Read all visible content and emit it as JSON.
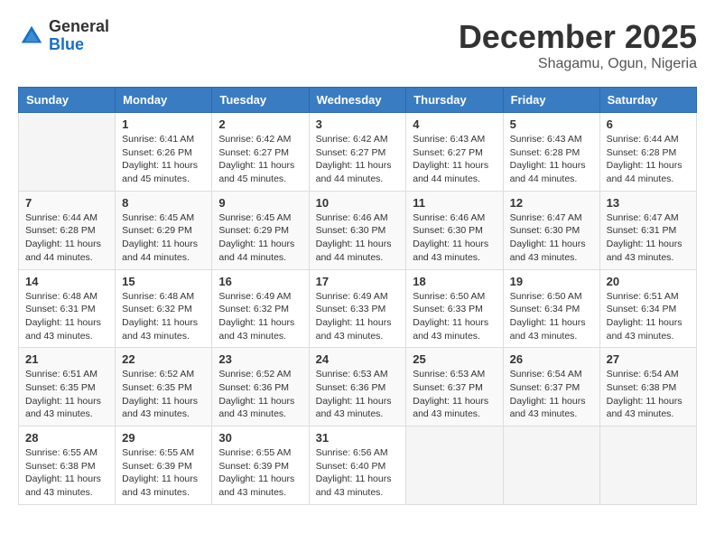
{
  "logo": {
    "general": "General",
    "blue": "Blue"
  },
  "title": "December 2025",
  "location": "Shagamu, Ogun, Nigeria",
  "weekdays": [
    "Sunday",
    "Monday",
    "Tuesday",
    "Wednesday",
    "Thursday",
    "Friday",
    "Saturday"
  ],
  "weeks": [
    [
      {
        "day": "",
        "info": ""
      },
      {
        "day": "1",
        "info": "Sunrise: 6:41 AM\nSunset: 6:26 PM\nDaylight: 11 hours\nand 45 minutes."
      },
      {
        "day": "2",
        "info": "Sunrise: 6:42 AM\nSunset: 6:27 PM\nDaylight: 11 hours\nand 45 minutes."
      },
      {
        "day": "3",
        "info": "Sunrise: 6:42 AM\nSunset: 6:27 PM\nDaylight: 11 hours\nand 44 minutes."
      },
      {
        "day": "4",
        "info": "Sunrise: 6:43 AM\nSunset: 6:27 PM\nDaylight: 11 hours\nand 44 minutes."
      },
      {
        "day": "5",
        "info": "Sunrise: 6:43 AM\nSunset: 6:28 PM\nDaylight: 11 hours\nand 44 minutes."
      },
      {
        "day": "6",
        "info": "Sunrise: 6:44 AM\nSunset: 6:28 PM\nDaylight: 11 hours\nand 44 minutes."
      }
    ],
    [
      {
        "day": "7",
        "info": "Sunrise: 6:44 AM\nSunset: 6:28 PM\nDaylight: 11 hours\nand 44 minutes."
      },
      {
        "day": "8",
        "info": "Sunrise: 6:45 AM\nSunset: 6:29 PM\nDaylight: 11 hours\nand 44 minutes."
      },
      {
        "day": "9",
        "info": "Sunrise: 6:45 AM\nSunset: 6:29 PM\nDaylight: 11 hours\nand 44 minutes."
      },
      {
        "day": "10",
        "info": "Sunrise: 6:46 AM\nSunset: 6:30 PM\nDaylight: 11 hours\nand 44 minutes."
      },
      {
        "day": "11",
        "info": "Sunrise: 6:46 AM\nSunset: 6:30 PM\nDaylight: 11 hours\nand 43 minutes."
      },
      {
        "day": "12",
        "info": "Sunrise: 6:47 AM\nSunset: 6:30 PM\nDaylight: 11 hours\nand 43 minutes."
      },
      {
        "day": "13",
        "info": "Sunrise: 6:47 AM\nSunset: 6:31 PM\nDaylight: 11 hours\nand 43 minutes."
      }
    ],
    [
      {
        "day": "14",
        "info": "Sunrise: 6:48 AM\nSunset: 6:31 PM\nDaylight: 11 hours\nand 43 minutes."
      },
      {
        "day": "15",
        "info": "Sunrise: 6:48 AM\nSunset: 6:32 PM\nDaylight: 11 hours\nand 43 minutes."
      },
      {
        "day": "16",
        "info": "Sunrise: 6:49 AM\nSunset: 6:32 PM\nDaylight: 11 hours\nand 43 minutes."
      },
      {
        "day": "17",
        "info": "Sunrise: 6:49 AM\nSunset: 6:33 PM\nDaylight: 11 hours\nand 43 minutes."
      },
      {
        "day": "18",
        "info": "Sunrise: 6:50 AM\nSunset: 6:33 PM\nDaylight: 11 hours\nand 43 minutes."
      },
      {
        "day": "19",
        "info": "Sunrise: 6:50 AM\nSunset: 6:34 PM\nDaylight: 11 hours\nand 43 minutes."
      },
      {
        "day": "20",
        "info": "Sunrise: 6:51 AM\nSunset: 6:34 PM\nDaylight: 11 hours\nand 43 minutes."
      }
    ],
    [
      {
        "day": "21",
        "info": "Sunrise: 6:51 AM\nSunset: 6:35 PM\nDaylight: 11 hours\nand 43 minutes."
      },
      {
        "day": "22",
        "info": "Sunrise: 6:52 AM\nSunset: 6:35 PM\nDaylight: 11 hours\nand 43 minutes."
      },
      {
        "day": "23",
        "info": "Sunrise: 6:52 AM\nSunset: 6:36 PM\nDaylight: 11 hours\nand 43 minutes."
      },
      {
        "day": "24",
        "info": "Sunrise: 6:53 AM\nSunset: 6:36 PM\nDaylight: 11 hours\nand 43 minutes."
      },
      {
        "day": "25",
        "info": "Sunrise: 6:53 AM\nSunset: 6:37 PM\nDaylight: 11 hours\nand 43 minutes."
      },
      {
        "day": "26",
        "info": "Sunrise: 6:54 AM\nSunset: 6:37 PM\nDaylight: 11 hours\nand 43 minutes."
      },
      {
        "day": "27",
        "info": "Sunrise: 6:54 AM\nSunset: 6:38 PM\nDaylight: 11 hours\nand 43 minutes."
      }
    ],
    [
      {
        "day": "28",
        "info": "Sunrise: 6:55 AM\nSunset: 6:38 PM\nDaylight: 11 hours\nand 43 minutes."
      },
      {
        "day": "29",
        "info": "Sunrise: 6:55 AM\nSunset: 6:39 PM\nDaylight: 11 hours\nand 43 minutes."
      },
      {
        "day": "30",
        "info": "Sunrise: 6:55 AM\nSunset: 6:39 PM\nDaylight: 11 hours\nand 43 minutes."
      },
      {
        "day": "31",
        "info": "Sunrise: 6:56 AM\nSunset: 6:40 PM\nDaylight: 11 hours\nand 43 minutes."
      },
      {
        "day": "",
        "info": ""
      },
      {
        "day": "",
        "info": ""
      },
      {
        "day": "",
        "info": ""
      }
    ]
  ]
}
